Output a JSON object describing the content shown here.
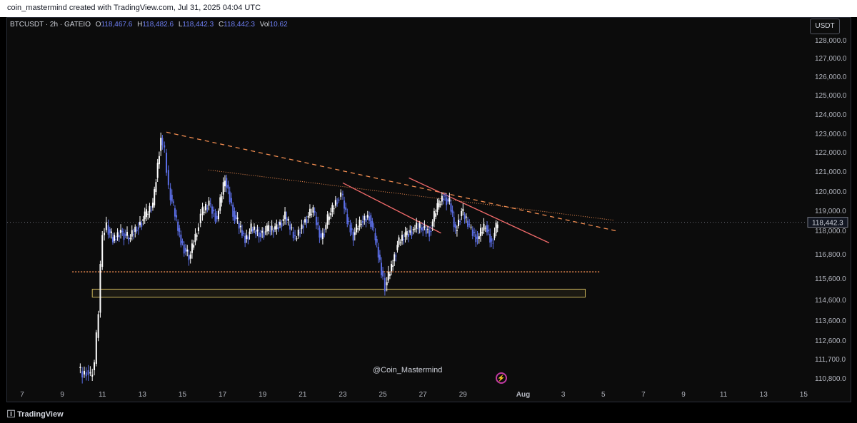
{
  "header": {
    "caption": "coin_mastermind created with TradingView.com, Jul 31, 2025 04:04 UTC"
  },
  "legend": {
    "symbol": "BTCUSDT · 2h · GATEIO",
    "open_label": "O",
    "open": "118,467.6",
    "high_label": "H",
    "high": "118,482.6",
    "low_label": "L",
    "low": "118,442.3",
    "close_label": "C",
    "close": "118,442.3",
    "vol_label": "Vol",
    "vol": "10.62"
  },
  "currency": "USDT",
  "watermark": "@Coin_Mastermind",
  "footer": {
    "logo_text": "TradingView"
  },
  "colors": {
    "up": "#ffffff",
    "down": "#5b6ee6",
    "trend_orange": "#f08c50",
    "trend_red": "#f06a6a",
    "zone": "#c8b25a",
    "bg": "#0c0c0c"
  },
  "chart_data": {
    "type": "line",
    "title": "",
    "xlabel": "",
    "ylabel": "",
    "y_tick_labels": [
      "128,000.0",
      "127,000.0",
      "126,000.0",
      "125,000.0",
      "124,000.0",
      "123,000.0",
      "122,000.0",
      "121,000.0",
      "120,000.0",
      "119,000.0",
      "118,000.0",
      "116,800.0",
      "115,600.0",
      "114,600.0",
      "113,600.0",
      "112,600.0",
      "111,700.0",
      "110,800.0"
    ],
    "y_tick_values": [
      128000,
      127000,
      126000,
      125000,
      124000,
      123000,
      122000,
      121000,
      120000,
      119000,
      118000,
      116800,
      115600,
      114600,
      113600,
      112600,
      111700,
      110800
    ],
    "x_tick_labels": [
      "7",
      "9",
      "11",
      "13",
      "15",
      "17",
      "19",
      "21",
      "23",
      "25",
      "27",
      "29",
      "Aug",
      "3",
      "5",
      "7",
      "9",
      "11",
      "13",
      "15"
    ],
    "x_tick_days": [
      7,
      9,
      11,
      13,
      15,
      17,
      19,
      21,
      23,
      25,
      27,
      29,
      32,
      34,
      36,
      38,
      40,
      42,
      44,
      46
    ],
    "last_price_label": "118,442.3",
    "last_price": 118442.3,
    "series": [
      {
        "x": [
          9.9,
          10.1,
          10.3,
          10.5,
          10.7,
          10.9,
          11.0,
          11.1,
          11.3,
          11.6,
          12.0,
          12.4,
          12.8,
          13.2,
          13.6,
          14.0,
          14.2,
          14.4,
          14.7,
          15.0,
          15.4,
          15.8,
          16.0,
          16.4,
          16.8,
          17.2,
          17.6,
          17.9,
          18.2,
          18.5,
          18.9,
          19.3,
          19.7,
          20.2,
          20.7,
          21.2,
          21.6,
          22.0,
          22.4,
          22.8,
          23.0,
          23.3,
          23.6,
          24.0,
          24.4,
          24.7,
          25.0,
          25.2,
          25.5,
          25.8,
          26.2,
          26.6,
          27.0,
          27.4,
          27.8,
          28.1,
          28.4,
          28.7,
          29.0,
          29.4,
          29.8,
          30.2,
          30.5,
          30.8
        ],
        "y": [
          111300,
          111000,
          111200,
          110900,
          111500,
          114000,
          116200,
          117800,
          118300,
          117500,
          118000,
          117600,
          118200,
          118700,
          119300,
          122800,
          122000,
          120200,
          118800,
          117500,
          116600,
          118000,
          118800,
          119400,
          118600,
          120700,
          119000,
          118200,
          117600,
          118100,
          117900,
          118000,
          118100,
          118700,
          117600,
          118600,
          119000,
          117600,
          118800,
          119600,
          119900,
          118500,
          117800,
          118500,
          118800,
          117600,
          116000,
          115300,
          116200,
          117300,
          117800,
          118100,
          118200,
          118000,
          119200,
          119800,
          119400,
          118000,
          119000,
          118200,
          117600,
          118300,
          117400,
          118400
        ]
      }
    ],
    "annotations": [
      {
        "type": "trendline",
        "style": "dashed",
        "color": "orange",
        "from": [
          14.2,
          123100
        ],
        "to": [
          36.7,
          118000
        ]
      },
      {
        "type": "trendline",
        "style": "dotted",
        "color": "orange",
        "from": [
          16.3,
          121100
        ],
        "to": [
          36.5,
          118550
        ]
      },
      {
        "type": "trendline",
        "style": "solid",
        "color": "red",
        "from": [
          23.0,
          120450
        ],
        "to": [
          27.9,
          117900
        ]
      },
      {
        "type": "trendline",
        "style": "solid",
        "color": "red",
        "from": [
          26.3,
          120700
        ],
        "to": [
          33.3,
          117400
        ]
      },
      {
        "type": "horizontal",
        "style": "dotted",
        "color": "orange",
        "y": 115950,
        "from_x": 9.5,
        "to_x": 35.8
      },
      {
        "type": "zone",
        "color": "zone",
        "y_top": 115120,
        "y_bottom": 114750,
        "from_x": 10.5,
        "to_x": 35.1
      }
    ]
  }
}
